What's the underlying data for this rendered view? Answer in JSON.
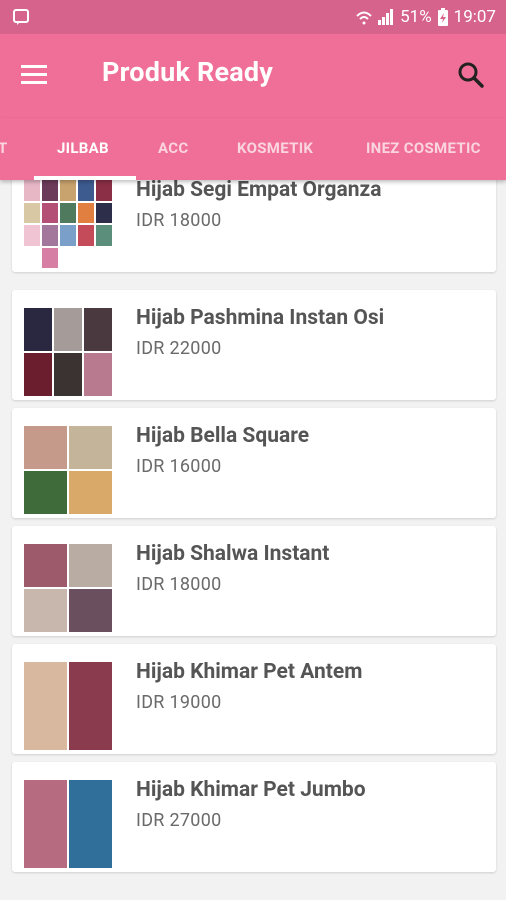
{
  "status_bar": {
    "battery": "51%",
    "time": "19:07"
  },
  "app_bar": {
    "title": "Produk Ready",
    "menu_icon": "hamburger-menu-icon",
    "search_icon": "search-icon"
  },
  "tabs": [
    {
      "label": "T",
      "active": false
    },
    {
      "label": "JILBAB",
      "active": true
    },
    {
      "label": "ACC",
      "active": false
    },
    {
      "label": "KOSMETIK",
      "active": false
    },
    {
      "label": "INEZ COSMETIC",
      "active": false
    }
  ],
  "products": [
    {
      "name": "Hijab Segi Empat Organza",
      "price": "IDR 18000"
    },
    {
      "name": "Hijab Pashmina Instan Osi",
      "price": "IDR 22000"
    },
    {
      "name": "Hijab Bella Square",
      "price": "IDR 16000"
    },
    {
      "name": "Hijab Shalwa Instant",
      "price": "IDR 18000"
    },
    {
      "name": "Hijab Khimar Pet Antem",
      "price": "IDR 19000"
    },
    {
      "name": "Hijab Khimar Pet Jumbo",
      "price": "IDR 27000"
    }
  ],
  "colors": {
    "status_bar": "#d6638c",
    "app_bar": "#f06f98",
    "background": "#f2f2f2",
    "card": "#ffffff"
  }
}
